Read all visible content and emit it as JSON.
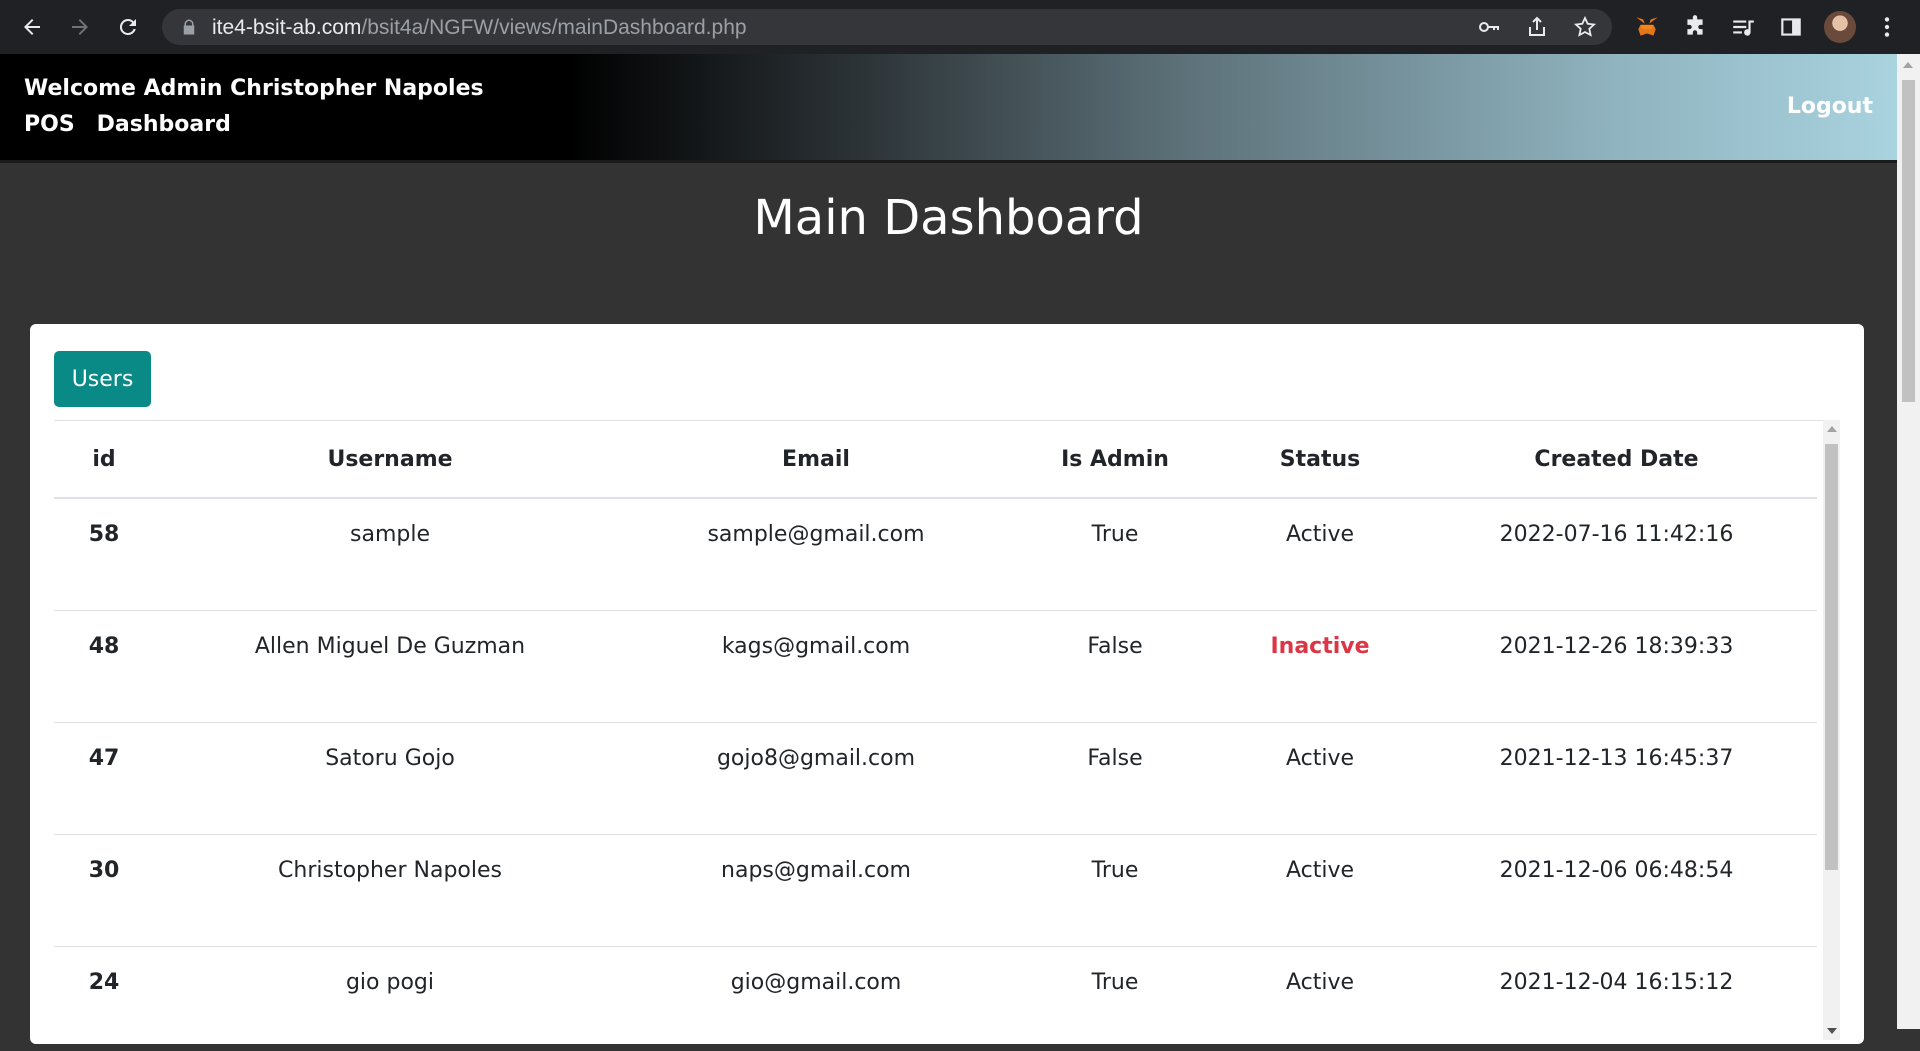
{
  "browser": {
    "url_host": "ite4-bsit-ab.com",
    "url_path": "/bsit4a/NGFW/views/mainDashboard.php",
    "icons": [
      "back-icon",
      "forward-icon",
      "reload-icon",
      "lock-icon",
      "key-icon",
      "share-icon",
      "star-icon",
      "metamask-icon",
      "extensions-icon",
      "media-icon",
      "sidepanel-icon",
      "avatar",
      "menu-icon"
    ]
  },
  "header": {
    "welcome": "Welcome Admin Christopher Napoles",
    "nav": [
      {
        "label": "POS"
      },
      {
        "label": "Dashboard"
      }
    ],
    "logout": "Logout"
  },
  "main": {
    "title": "Main Dashboard",
    "users_button": "Users",
    "table": {
      "columns": [
        "id",
        "Username",
        "Email",
        "Is Admin",
        "Status",
        "Created Date"
      ],
      "rows": [
        {
          "id": "58",
          "username": "sample",
          "email": "sample@gmail.com",
          "is_admin": "True",
          "status": "Active",
          "created": "2022-07-16 11:42:16"
        },
        {
          "id": "48",
          "username": "Allen Miguel De Guzman",
          "email": "kags@gmail.com",
          "is_admin": "False",
          "status": "Inactive",
          "created": "2021-12-26 18:39:33"
        },
        {
          "id": "47",
          "username": "Satoru Gojo",
          "email": "gojo8@gmail.com",
          "is_admin": "False",
          "status": "Active",
          "created": "2021-12-13 16:45:37"
        },
        {
          "id": "30",
          "username": "Christopher Napoles",
          "email": "naps@gmail.com",
          "is_admin": "True",
          "status": "Active",
          "created": "2021-12-06 06:48:54"
        },
        {
          "id": "24",
          "username": "gio pogi",
          "email": "gio@gmail.com",
          "is_admin": "True",
          "status": "Active",
          "created": "2021-12-04 16:15:12"
        }
      ]
    }
  },
  "colors": {
    "accent": "#0a8a87",
    "inactive": "#dc3545",
    "page_bg": "#333333"
  }
}
